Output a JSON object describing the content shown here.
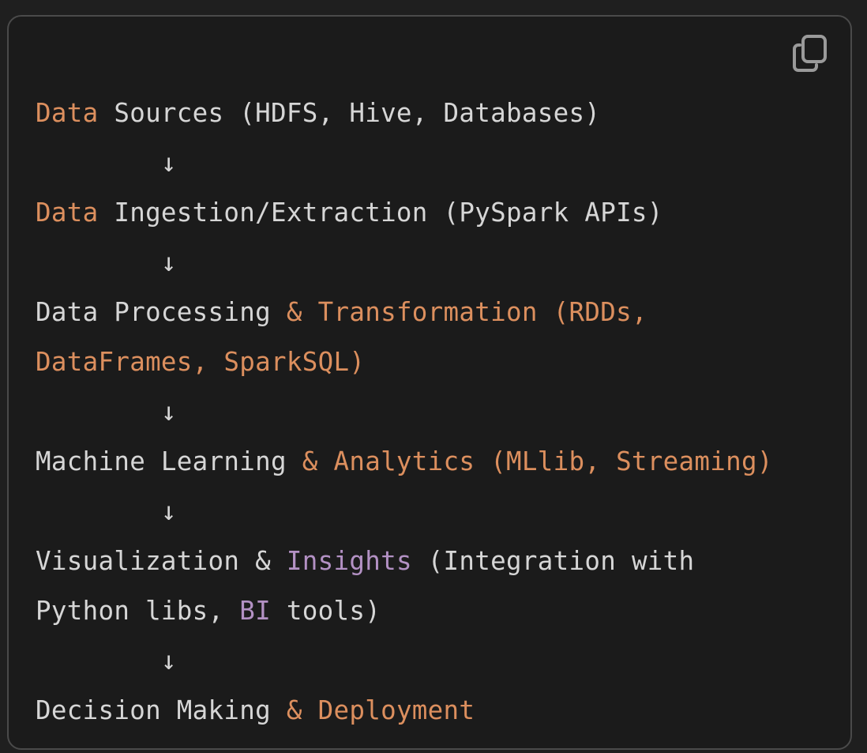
{
  "code_block": {
    "copy_icon": "copy-icon",
    "colors": {
      "background": "#1b1b1b",
      "border": "#4a4a4a",
      "plain": "#d6d6d6",
      "orange": "#dc8f5e",
      "purple": "#b391c4"
    },
    "lines": [
      [
        {
          "t": "Data",
          "c": "orange"
        },
        {
          "t": " Sources (HDFS, Hive, Databases)",
          "c": "plain"
        }
      ],
      [
        {
          "t": "        ↓",
          "c": "plain"
        }
      ],
      [
        {
          "t": "Data",
          "c": "orange"
        },
        {
          "t": " Ingestion/Extraction (PySpark APIs)",
          "c": "plain"
        }
      ],
      [
        {
          "t": "        ↓",
          "c": "plain"
        }
      ],
      [
        {
          "t": "Data Processing ",
          "c": "plain"
        },
        {
          "t": "& Transformation (RDDs,",
          "c": "orange"
        }
      ],
      [
        {
          "t": "DataFrames, SparkSQL)",
          "c": "orange"
        }
      ],
      [
        {
          "t": "        ↓",
          "c": "plain"
        }
      ],
      [
        {
          "t": "Machine Learning ",
          "c": "plain"
        },
        {
          "t": "& Analytics (MLlib, Streaming)",
          "c": "orange"
        }
      ],
      [
        {
          "t": "        ↓",
          "c": "plain"
        }
      ],
      [
        {
          "t": "Visualization & ",
          "c": "plain"
        },
        {
          "t": "Insights",
          "c": "purple"
        },
        {
          "t": " (Integration with",
          "c": "plain"
        }
      ],
      [
        {
          "t": "Python libs, ",
          "c": "plain"
        },
        {
          "t": "BI",
          "c": "purple"
        },
        {
          "t": " tools)",
          "c": "plain"
        }
      ],
      [
        {
          "t": "        ↓",
          "c": "plain"
        }
      ],
      [
        {
          "t": "Decision Making ",
          "c": "plain"
        },
        {
          "t": "& Deployment",
          "c": "orange"
        }
      ]
    ]
  }
}
